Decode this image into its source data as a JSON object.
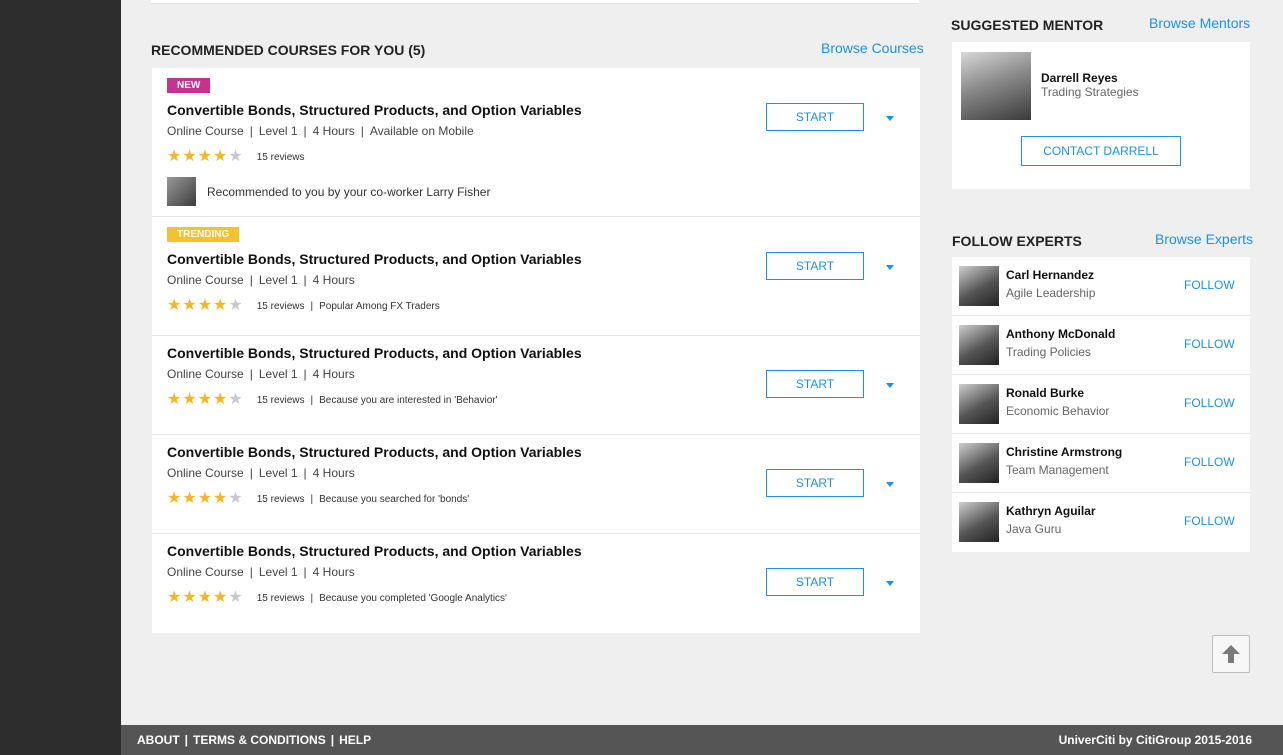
{
  "courses_section": {
    "title": "RECOMMENDED COURSES FOR YOU (5)",
    "browse_link": "Browse Courses",
    "start_label": "START",
    "items": [
      {
        "badge": "NEW",
        "title": "Convertible Bonds, Structured Products, and Option Variables",
        "meta": [
          "Online Course",
          "Level 1",
          "4 Hours",
          "Available on Mobile"
        ],
        "rating": 4,
        "reviews": "15 reviews",
        "reason": "",
        "recommendation": "Recommended to you by your co-worker Larry Fisher"
      },
      {
        "badge": "TRENDING",
        "title": "Convertible Bonds, Structured Products, and Option Variables",
        "meta": [
          "Online Course",
          "Level 1",
          "4 Hours"
        ],
        "rating": 4,
        "reviews": "15 reviews",
        "reason": "Popular Among FX Traders"
      },
      {
        "title": "Convertible Bonds, Structured Products, and Option Variables",
        "meta": [
          "Online Course",
          "Level 1",
          "4 Hours"
        ],
        "rating": 4,
        "reviews": "15 reviews",
        "reason": "Because you are interested in 'Behavior'"
      },
      {
        "title": "Convertible Bonds, Structured Products, and Option Variables",
        "meta": [
          "Online Course",
          "Level 1",
          "4 Hours"
        ],
        "rating": 4,
        "reviews": "15 reviews",
        "reason": "Because you searched for 'bonds'"
      },
      {
        "title": "Convertible Bonds, Structured Products, and Option Variables",
        "meta": [
          "Online Course",
          "Level 1",
          "4 Hours"
        ],
        "rating": 4,
        "reviews": "15 reviews",
        "reason": "Because you completed 'Google Analytics'"
      }
    ]
  },
  "mentor_section": {
    "title": "SUGGESTED MENTOR",
    "browse_link": "Browse Mentors",
    "name": "Darrell Reyes",
    "role": "Trading Strategies",
    "contact_label": "CONTACT DARRELL"
  },
  "experts_section": {
    "title": "FOLLOW EXPERTS",
    "browse_link": "Browse Experts",
    "follow_label": "FOLLOW",
    "items": [
      {
        "name": "Carl Hernandez",
        "role": "Agile Leadership"
      },
      {
        "name": "Anthony McDonald",
        "role": "Trading Policies"
      },
      {
        "name": "Ronald Burke",
        "role": "Economic Behavior"
      },
      {
        "name": "Christine Armstrong",
        "role": "Team Management"
      },
      {
        "name": "Kathryn Aguilar",
        "role": "Java Guru"
      }
    ]
  },
  "scroll_top_icon": "arrow-up-icon",
  "footer": {
    "links": [
      "ABOUT",
      "TERMS & CONDITIONS",
      "HELP"
    ],
    "copyright": "UniverCiti by CitiGroup 2015-2016"
  },
  "colors": {
    "accent": "#1e90e6",
    "badge_new": "#c6338f",
    "badge_trending": "#f5c12e",
    "star": "#f5b625",
    "footer": "#555555",
    "left_rail": "#2d2d2d"
  }
}
